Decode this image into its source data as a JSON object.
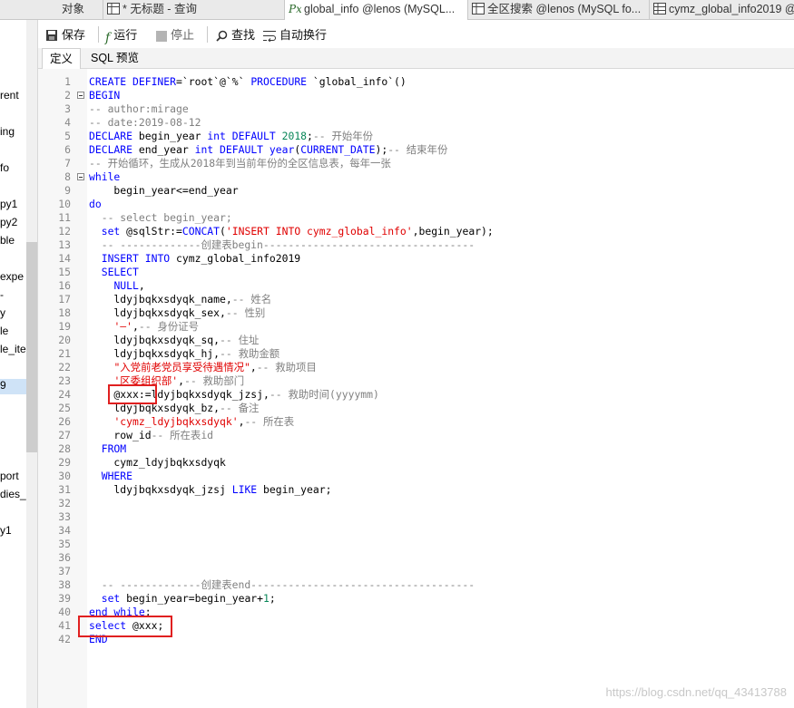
{
  "tabs": [
    {
      "label": "对象",
      "icon": "none"
    },
    {
      "label": "* 无标题 - 查询",
      "icon": "query-grid-icon"
    },
    {
      "label": "global_info @lenos (MySQL...",
      "icon": "procedure-icon"
    },
    {
      "label": "全区搜索 @lenos (MySQL fo...",
      "icon": "query-grid-icon"
    },
    {
      "label": "cymz_global_info2019 @",
      "icon": "table-grid-icon"
    }
  ],
  "sidebar": {
    "items": [
      "rent",
      "ing",
      "fo",
      "py1",
      "py2",
      "ble",
      "expe",
      "-",
      "y",
      "le",
      "le_ite",
      "9",
      "port",
      "dies_",
      "y1"
    ]
  },
  "toolbar": {
    "save": "保存",
    "run": "运行",
    "stop": "停止",
    "find": "查找",
    "wrap": "自动换行"
  },
  "subtabs": [
    "定义",
    "SQL 预览"
  ],
  "code": [
    [
      [
        "kw",
        "CREATE DEFINER"
      ],
      [
        "p",
        "=`root`@`%` "
      ],
      [
        "kw",
        "PROCEDURE"
      ],
      [
        "p",
        " `global_info`()"
      ]
    ],
    [
      [
        "kw",
        "BEGIN"
      ]
    ],
    [
      [
        "cm",
        "-- author:mirage"
      ]
    ],
    [
      [
        "cm",
        "-- date:2019-08-12"
      ]
    ],
    [
      [
        "kw",
        "DECLARE"
      ],
      [
        "p",
        " begin_year "
      ],
      [
        "kw",
        "int DEFAULT"
      ],
      [
        "p",
        " "
      ],
      [
        "nm",
        "2018"
      ],
      [
        "p",
        ";"
      ],
      [
        "cm",
        "-- 开始年份"
      ]
    ],
    [
      [
        "kw",
        "DECLARE"
      ],
      [
        "p",
        " end_year "
      ],
      [
        "kw",
        "int DEFAULT year"
      ],
      [
        "p",
        "("
      ],
      [
        "kw",
        "CURRENT_DATE"
      ],
      [
        "p",
        ");"
      ],
      [
        "cm",
        "-- 结束年份"
      ]
    ],
    [
      [
        "cm",
        "-- 开始循环，生成从2018年到当前年份的全区信息表，每年一张"
      ]
    ],
    [
      [
        "kw",
        "while"
      ]
    ],
    [
      [
        "p",
        "    begin_year<=end_year"
      ]
    ],
    [
      [
        "kw",
        "do"
      ]
    ],
    [
      [
        "cm",
        "  -- select begin_year;"
      ]
    ],
    [
      [
        "p",
        "  "
      ],
      [
        "kw",
        "set"
      ],
      [
        "p",
        " @sqlStr:="
      ],
      [
        "fn",
        "CONCAT"
      ],
      [
        "p",
        "("
      ],
      [
        "st",
        "'INSERT INTO cymz_global_info'"
      ],
      [
        "p",
        ",begin_year);"
      ]
    ],
    [
      [
        "cm",
        "  -- -------------创建表begin----------------------------------"
      ]
    ],
    [
      [
        "p",
        "  "
      ],
      [
        "kw",
        "INSERT INTO"
      ],
      [
        "p",
        " cymz_global_info2019"
      ]
    ],
    [
      [
        "p",
        "  "
      ],
      [
        "kw",
        "SELECT"
      ]
    ],
    [
      [
        "p",
        "    "
      ],
      [
        "kw",
        "NULL"
      ],
      [
        "p",
        ","
      ]
    ],
    [
      [
        "p",
        "    ldyjbqkxsdyqk_name,"
      ],
      [
        "cm",
        "-- 姓名"
      ]
    ],
    [
      [
        "p",
        "    ldyjbqkxsdyqk_sex,"
      ],
      [
        "cm",
        "-- 性别"
      ]
    ],
    [
      [
        "p",
        "    "
      ],
      [
        "st",
        "'—'"
      ],
      [
        "p",
        ","
      ],
      [
        "cm",
        "-- 身份证号"
      ]
    ],
    [
      [
        "p",
        "    ldyjbqkxsdyqk_sq,"
      ],
      [
        "cm",
        "-- 住址"
      ]
    ],
    [
      [
        "p",
        "    ldyjbqkxsdyqk_hj,"
      ],
      [
        "cm",
        "-- 救助金额"
      ]
    ],
    [
      [
        "p",
        "    "
      ],
      [
        "st",
        "\"入党前老党员享受待遇情况\""
      ],
      [
        "p",
        ","
      ],
      [
        "cm",
        "-- 救助项目"
      ]
    ],
    [
      [
        "p",
        "    "
      ],
      [
        "st",
        "'区委组织部'"
      ],
      [
        "p",
        ","
      ],
      [
        "cm",
        "-- 救助部门"
      ]
    ],
    [
      [
        "p",
        "    @xxx:=ldyjbqkxsdyqk_jzsj,"
      ],
      [
        "cm",
        "-- 救助时间(yyyymm)"
      ]
    ],
    [
      [
        "p",
        "    ldyjbqkxsdyqk_bz,"
      ],
      [
        "cm",
        "-- 备注"
      ]
    ],
    [
      [
        "p",
        "    "
      ],
      [
        "st",
        "'cymz_ldyjbqkxsdyqk'"
      ],
      [
        "p",
        ","
      ],
      [
        "cm",
        "-- 所在表"
      ]
    ],
    [
      [
        "p",
        "    row_id"
      ],
      [
        "cm",
        "-- 所在表id"
      ]
    ],
    [
      [
        "p",
        "  "
      ],
      [
        "kw",
        "FROM"
      ]
    ],
    [
      [
        "p",
        "    cymz_ldyjbqkxsdyqk"
      ]
    ],
    [
      [
        "p",
        "  "
      ],
      [
        "kw",
        "WHERE"
      ]
    ],
    [
      [
        "p",
        "    ldyjbqkxsdyqk_jzsj "
      ],
      [
        "kw",
        "LIKE"
      ],
      [
        "p",
        " begin_year;"
      ]
    ],
    [],
    [],
    [],
    [],
    [],
    [],
    [
      [
        "cm",
        "  -- -------------创建表end------------------------------------"
      ]
    ],
    [
      [
        "p",
        "  "
      ],
      [
        "kw",
        "set"
      ],
      [
        "p",
        " begin_year=begin_year+"
      ],
      [
        "nm",
        "1"
      ],
      [
        "p",
        ";"
      ]
    ],
    [
      [
        "kw",
        "end while"
      ],
      [
        "p",
        ";"
      ]
    ],
    [
      [
        "kw",
        "select"
      ],
      [
        "p",
        " @xxx;"
      ]
    ],
    [
      [
        "kw",
        "END"
      ]
    ]
  ],
  "folds": [
    2,
    8
  ],
  "watermark": "https://blog.csdn.net/qq_43413788"
}
